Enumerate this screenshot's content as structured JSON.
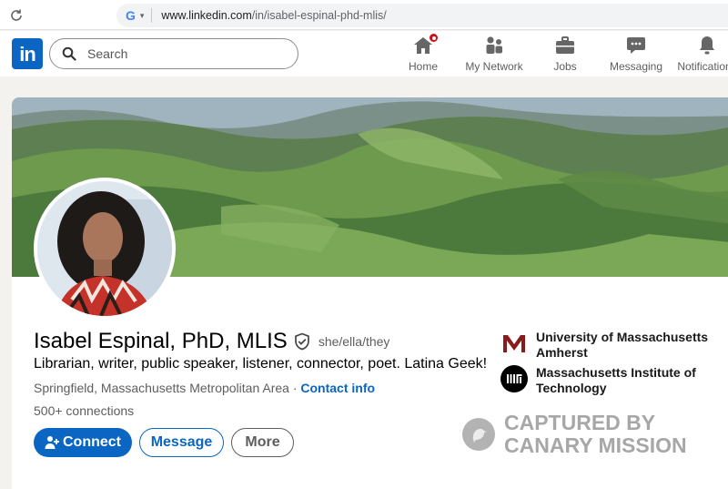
{
  "browser": {
    "url_domain": "www.linkedin.com",
    "url_path": "/in/isabel-espinal-phd-mlis/",
    "engine_logo": "G"
  },
  "nav": {
    "logo_text": "in",
    "search_placeholder": "Search",
    "items": [
      {
        "label": "Home",
        "icon": "home-icon",
        "badge": true
      },
      {
        "label": "My Network",
        "icon": "network-icon"
      },
      {
        "label": "Jobs",
        "icon": "briefcase-icon"
      },
      {
        "label": "Messaging",
        "icon": "chat-icon"
      },
      {
        "label": "Notifications",
        "icon": "bell-icon"
      }
    ]
  },
  "profile": {
    "name": "Isabel Espinal, PhD, MLIS",
    "pronouns": "she/ella/they",
    "headline": "Librarian, writer, public speaker, listener, connector, poet. Latina Geek!",
    "location": "Springfield, Massachusetts Metropolitan Area",
    "location_sep": " · ",
    "contact_info": "Contact info",
    "connections": "500+ connections",
    "buttons": {
      "connect": "Connect",
      "message": "Message",
      "more": "More"
    },
    "education": [
      {
        "name": "University of Massachusetts Amherst",
        "logo": "umass-logo"
      },
      {
        "name": "Massachusetts Institute of Technology",
        "logo": "mit-logo"
      }
    ]
  },
  "watermark": {
    "line1": "CAPTURED BY",
    "line2": "CANARY MISSION"
  },
  "colors": {
    "linkedin_blue": "#0a66c2",
    "notification_red": "#cc1016",
    "umass_maroon": "#881c1c"
  }
}
